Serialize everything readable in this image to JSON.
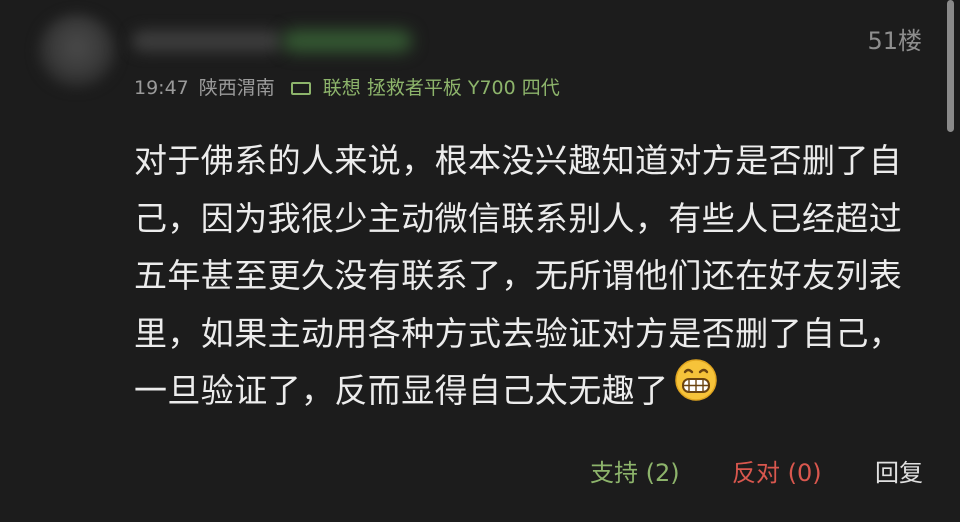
{
  "post": {
    "floor_label": "51楼",
    "time": "19:47",
    "location": "陕西渭南",
    "device": "联想 拯救者平板 Y700 四代",
    "content_lines": [
      "对于佛系的人来说，根本没兴趣知道对方是否删了自",
      "己，因为我很少主动微信联系别人，有些人已经超过",
      "五年甚至更久没有联系了，无所谓他们还在好友列表",
      "里，如果主动用各种方式去验证对方是否删了自己，",
      "一旦验证了，反而显得自己太无趣了"
    ],
    "emoji": "grinning-face-emoji"
  },
  "actions": {
    "support_label": "支持 (2)",
    "oppose_label": "反对 (0)",
    "reply_label": "回复"
  },
  "colors": {
    "background": "#1c1c1c",
    "text": "#ececec",
    "meta": "#9a9a9a",
    "accent_green": "#8db46b",
    "accent_red": "#d9574e"
  }
}
